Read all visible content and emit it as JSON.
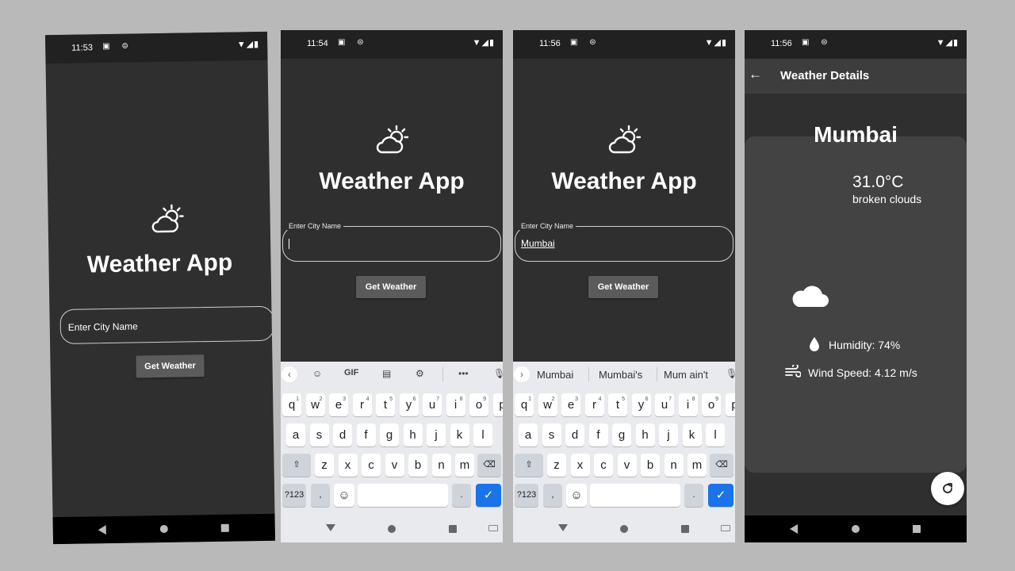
{
  "status_bar": {
    "screen1_time": "11:53",
    "screen2_time": "11:54",
    "screen3_time": "11:56",
    "screen4_time": "11:56"
  },
  "home": {
    "title": "Weather App",
    "input_placeholder": "Enter City Name",
    "input_label": "Enter City Name",
    "button_label": "Get Weather",
    "typed_city": "Mumbai"
  },
  "keyboard": {
    "tool_gif": "GIF",
    "suggestions": [
      "Mumbai",
      "Mumbai's",
      "Mum ain't"
    ],
    "row1": [
      "q",
      "w",
      "e",
      "r",
      "t",
      "y",
      "u",
      "i",
      "o",
      "p"
    ],
    "row1_hints": [
      "1",
      "2",
      "3",
      "4",
      "5",
      "6",
      "7",
      "8",
      "9",
      "0"
    ],
    "row2": [
      "a",
      "s",
      "d",
      "f",
      "g",
      "h",
      "j",
      "k",
      "l"
    ],
    "row3": [
      "z",
      "x",
      "c",
      "v",
      "b",
      "n",
      "m"
    ],
    "symbols_key": "?123",
    "comma_key": ",",
    "period_key": "."
  },
  "details": {
    "appbar_title": "Weather Details",
    "city": "Mumbai",
    "temperature": "31.0°C",
    "description": "broken clouds",
    "humidity": "Humidity: 74%",
    "wind": "Wind Speed: 4.12 m/s"
  },
  "colors": {
    "background": "#2f2f2f",
    "status_bar": "#212121",
    "button": "#5b5b5b",
    "keyboard": "#e9eaee",
    "enter_key": "#1a73e8"
  },
  "icons": [
    "weather-partly-cloudy-icon",
    "cloud-icon",
    "water-drop-icon",
    "wind-icon",
    "refresh-icon",
    "back-arrow-icon",
    "wifi-icon",
    "signal-icon",
    "battery-icon"
  ]
}
